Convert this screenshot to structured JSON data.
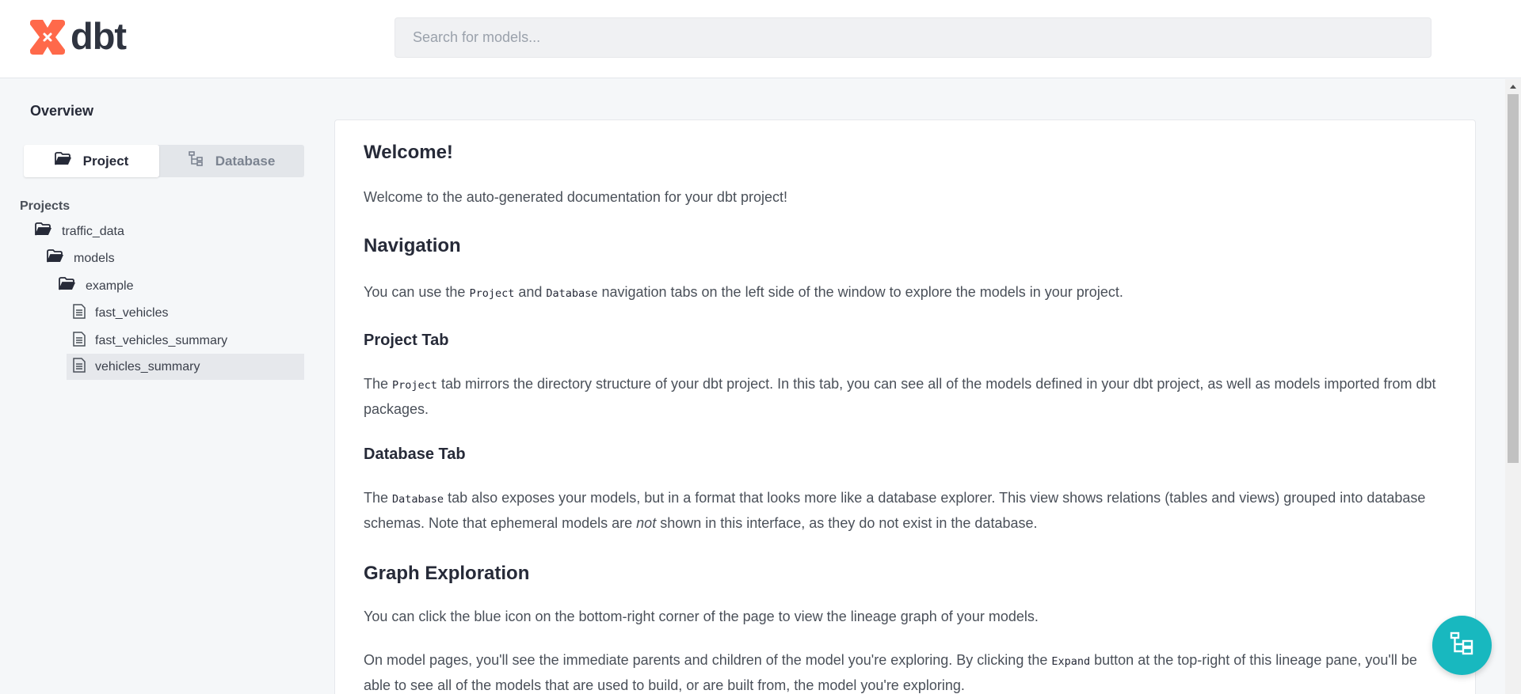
{
  "header": {
    "logo_text": "dbt",
    "search_placeholder": "Search for models..."
  },
  "sidebar": {
    "overview_label": "Overview",
    "tabs": [
      {
        "label": "Project",
        "icon": "folder-open-icon",
        "active": true
      },
      {
        "label": "Database",
        "icon": "tree-structure-icon",
        "active": false
      }
    ],
    "projects_heading": "Projects",
    "tree": [
      {
        "label": "traffic_data",
        "icon": "folder-open-icon",
        "depth": 0
      },
      {
        "label": "models",
        "icon": "folder-open-icon",
        "depth": 1
      },
      {
        "label": "example",
        "icon": "folder-open-icon",
        "depth": 2
      },
      {
        "label": "fast_vehicles",
        "icon": "file-icon",
        "depth": 3
      },
      {
        "label": "fast_vehicles_summary",
        "icon": "file-icon",
        "depth": 3
      },
      {
        "label": "vehicles_summary",
        "icon": "file-icon",
        "depth": 3,
        "selected": true
      }
    ]
  },
  "main": {
    "welcome_title": "Welcome!",
    "welcome_text": "Welcome to the auto-generated documentation for your dbt project!",
    "navigation_title": "Navigation",
    "navigation_text": {
      "t1": "You can use the ",
      "code1": "Project",
      "t2": " and ",
      "code2": "Database",
      "t3": " navigation tabs on the left side of the window to explore the models in your project."
    },
    "project_tab_title": "Project Tab",
    "project_tab_text": {
      "t1": "The ",
      "code1": "Project",
      "t2": " tab mirrors the directory structure of your dbt project. In this tab, you can see all of the models defined in your dbt project, as well as models imported from dbt packages."
    },
    "database_tab_title": "Database Tab",
    "database_tab_text": {
      "t1": "The ",
      "code1": "Database",
      "t2": " tab also exposes your models, but in a format that looks more like a database explorer. This view shows relations (tables and views) grouped into database schemas. Note that ephemeral models are ",
      "em1": "not",
      "t3": " shown in this interface, as they do not exist in the database."
    },
    "graph_title": "Graph Exploration",
    "graph_text": "You can click the blue icon on the bottom-right corner of the page to view the lineage graph of your models.",
    "graph_text2": {
      "t1": "On model pages, you'll see the immediate parents and children of the model you're exploring. By clicking the ",
      "code1": "Expand",
      "t2": " button at the top-right of this lineage pane, you'll be able to see all of the models that are used to build, or are built from, the model you're exploring."
    }
  },
  "fab": {
    "icon": "lineage-graph-icon"
  },
  "colors": {
    "brand_orange": "#ff694a",
    "fab_teal": "#18b8bf",
    "text_dark": "#262a38",
    "text_body": "#4a5059",
    "background": "#f5f7f9"
  }
}
